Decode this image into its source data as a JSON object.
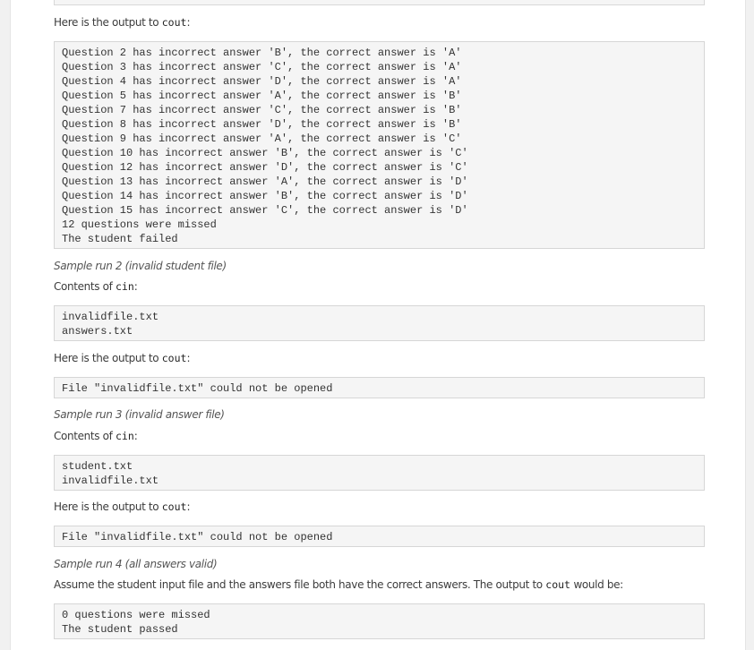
{
  "output_intro_1": "Here is the output to",
  "cout_word": "cout",
  "colon": ":",
  "run1_output": [
    "Question 2 has incorrect answer 'B', the correct answer is 'A'",
    "Question 3 has incorrect answer 'C', the correct answer is 'A'",
    "Question 4 has incorrect answer 'D', the correct answer is 'A'",
    "Question 5 has incorrect answer 'A', the correct answer is 'B'",
    "Question 7 has incorrect answer 'C', the correct answer is 'B'",
    "Question 8 has incorrect answer 'D', the correct answer is 'B'",
    "Question 9 has incorrect answer 'A', the correct answer is 'C'",
    "Question 10 has incorrect answer 'B', the correct answer is 'C'",
    "Question 12 has incorrect answer 'D', the correct answer is 'C'",
    "Question 13 has incorrect answer 'A', the correct answer is 'D'",
    "Question 14 has incorrect answer 'B', the correct answer is 'D'",
    "Question 15 has incorrect answer 'C', the correct answer is 'D'",
    "12 questions were missed",
    "The student failed"
  ],
  "run2": {
    "heading": "Sample run 2 (invalid student file)",
    "contents_label": "Contents of",
    "cin_word": "cin",
    "input": [
      "invalidfile.txt",
      "answers.txt"
    ],
    "output_label": "Here is the output to",
    "output": [
      "File \"invalidfile.txt\" could not be opened"
    ]
  },
  "run3": {
    "heading": "Sample run 3 (invalid answer file)",
    "contents_label": "Contents of",
    "cin_word": "cin",
    "input": [
      "student.txt",
      "invalidfile.txt"
    ],
    "output_label": "Here is the output to",
    "output": [
      "File \"invalidfile.txt\" could not be opened"
    ]
  },
  "run4": {
    "heading": "Sample run 4 (all answers valid)",
    "description_before": "Assume the student input file and the answers file both have the correct answers. The output to",
    "description_after": "would be:",
    "output": [
      "0 questions were missed",
      "The student passed"
    ]
  }
}
